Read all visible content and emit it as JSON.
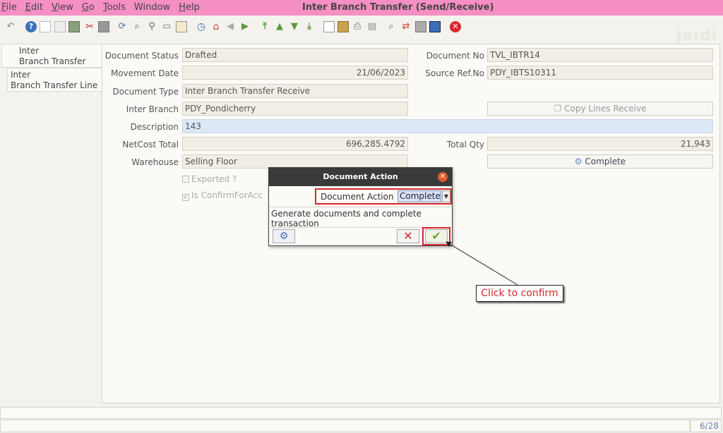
{
  "menu": {
    "items": [
      {
        "key": "F",
        "rest": "ile"
      },
      {
        "key": "E",
        "rest": "dit"
      },
      {
        "key": "V",
        "rest": "iew"
      },
      {
        "key": "G",
        "rest": "o"
      },
      {
        "key": "T",
        "rest": "ools"
      },
      {
        "key": "",
        "rest": "Window"
      },
      {
        "key": "H",
        "rest": "elp"
      }
    ]
  },
  "window": {
    "title": "Inter Branch Transfer (Send/Receive)"
  },
  "logo": {
    "text": "jaidi"
  },
  "tabs": {
    "tab1_line1": "Inter",
    "tab1_line2": "Branch Transfer",
    "tab2_line1": "Inter",
    "tab2_line2": "Branch Transfer Line"
  },
  "form": {
    "document_status_label": "Document Status",
    "document_status_value": "Drafted",
    "document_no_label": "Document No",
    "document_no_value": "TVL_IBTR14",
    "movement_date_label": "Movement Date",
    "movement_date_value": "21/06/2023",
    "source_ref_label": "Source Ref.No",
    "source_ref_value": "PDY_IBTS10311",
    "document_type_label": "Document Type",
    "document_type_value": "Inter Branch Transfer Receive",
    "inter_branch_label": "Inter Branch",
    "inter_branch_value": "PDY_Pondicherry",
    "copy_lines_label": "Copy Lines Receive",
    "description_label": "Description",
    "description_value": "143",
    "netcost_label": "NetCost Total",
    "netcost_value": "696,285.4792",
    "total_qty_label": "Total Qty",
    "total_qty_value": "21,943",
    "warehouse_label": "Warehouse",
    "warehouse_value": "Selling Floor",
    "complete_label": "Complete",
    "exported_label": "Exported ?",
    "confirm_label": "Is ConfirmForAcc"
  },
  "dialog": {
    "title": "Document Action",
    "select_label": "Document Action",
    "selected_value": "Complete",
    "message": "Generate documents and complete transaction"
  },
  "callout": {
    "text": "Click to confirm"
  },
  "status": {
    "pager": "6/28"
  },
  "colors": {
    "title_bar": "#f58fc4",
    "highlight": "#d9262c",
    "confirm": "#6da432"
  }
}
